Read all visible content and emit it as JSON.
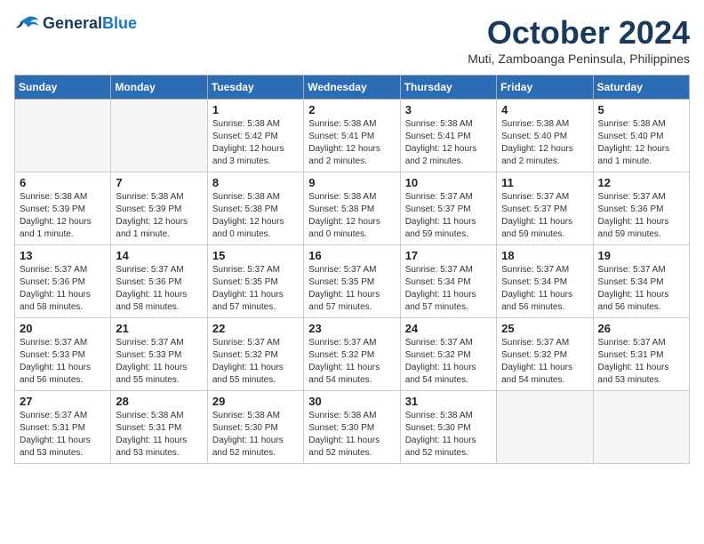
{
  "header": {
    "logo_line1": "General",
    "logo_line2": "Blue",
    "month_title": "October 2024",
    "subtitle": "Muti, Zamboanga Peninsula, Philippines"
  },
  "weekdays": [
    "Sunday",
    "Monday",
    "Tuesday",
    "Wednesday",
    "Thursday",
    "Friday",
    "Saturday"
  ],
  "weeks": [
    [
      {
        "day": "",
        "empty": true
      },
      {
        "day": "",
        "empty": true
      },
      {
        "day": "1",
        "sunrise": "Sunrise: 5:38 AM",
        "sunset": "Sunset: 5:42 PM",
        "daylight": "Daylight: 12 hours and 3 minutes."
      },
      {
        "day": "2",
        "sunrise": "Sunrise: 5:38 AM",
        "sunset": "Sunset: 5:41 PM",
        "daylight": "Daylight: 12 hours and 2 minutes."
      },
      {
        "day": "3",
        "sunrise": "Sunrise: 5:38 AM",
        "sunset": "Sunset: 5:41 PM",
        "daylight": "Daylight: 12 hours and 2 minutes."
      },
      {
        "day": "4",
        "sunrise": "Sunrise: 5:38 AM",
        "sunset": "Sunset: 5:40 PM",
        "daylight": "Daylight: 12 hours and 2 minutes."
      },
      {
        "day": "5",
        "sunrise": "Sunrise: 5:38 AM",
        "sunset": "Sunset: 5:40 PM",
        "daylight": "Daylight: 12 hours and 1 minute."
      }
    ],
    [
      {
        "day": "6",
        "sunrise": "Sunrise: 5:38 AM",
        "sunset": "Sunset: 5:39 PM",
        "daylight": "Daylight: 12 hours and 1 minute."
      },
      {
        "day": "7",
        "sunrise": "Sunrise: 5:38 AM",
        "sunset": "Sunset: 5:39 PM",
        "daylight": "Daylight: 12 hours and 1 minute."
      },
      {
        "day": "8",
        "sunrise": "Sunrise: 5:38 AM",
        "sunset": "Sunset: 5:38 PM",
        "daylight": "Daylight: 12 hours and 0 minutes."
      },
      {
        "day": "9",
        "sunrise": "Sunrise: 5:38 AM",
        "sunset": "Sunset: 5:38 PM",
        "daylight": "Daylight: 12 hours and 0 minutes."
      },
      {
        "day": "10",
        "sunrise": "Sunrise: 5:37 AM",
        "sunset": "Sunset: 5:37 PM",
        "daylight": "Daylight: 11 hours and 59 minutes."
      },
      {
        "day": "11",
        "sunrise": "Sunrise: 5:37 AM",
        "sunset": "Sunset: 5:37 PM",
        "daylight": "Daylight: 11 hours and 59 minutes."
      },
      {
        "day": "12",
        "sunrise": "Sunrise: 5:37 AM",
        "sunset": "Sunset: 5:36 PM",
        "daylight": "Daylight: 11 hours and 59 minutes."
      }
    ],
    [
      {
        "day": "13",
        "sunrise": "Sunrise: 5:37 AM",
        "sunset": "Sunset: 5:36 PM",
        "daylight": "Daylight: 11 hours and 58 minutes."
      },
      {
        "day": "14",
        "sunrise": "Sunrise: 5:37 AM",
        "sunset": "Sunset: 5:36 PM",
        "daylight": "Daylight: 11 hours and 58 minutes."
      },
      {
        "day": "15",
        "sunrise": "Sunrise: 5:37 AM",
        "sunset": "Sunset: 5:35 PM",
        "daylight": "Daylight: 11 hours and 57 minutes."
      },
      {
        "day": "16",
        "sunrise": "Sunrise: 5:37 AM",
        "sunset": "Sunset: 5:35 PM",
        "daylight": "Daylight: 11 hours and 57 minutes."
      },
      {
        "day": "17",
        "sunrise": "Sunrise: 5:37 AM",
        "sunset": "Sunset: 5:34 PM",
        "daylight": "Daylight: 11 hours and 57 minutes."
      },
      {
        "day": "18",
        "sunrise": "Sunrise: 5:37 AM",
        "sunset": "Sunset: 5:34 PM",
        "daylight": "Daylight: 11 hours and 56 minutes."
      },
      {
        "day": "19",
        "sunrise": "Sunrise: 5:37 AM",
        "sunset": "Sunset: 5:34 PM",
        "daylight": "Daylight: 11 hours and 56 minutes."
      }
    ],
    [
      {
        "day": "20",
        "sunrise": "Sunrise: 5:37 AM",
        "sunset": "Sunset: 5:33 PM",
        "daylight": "Daylight: 11 hours and 56 minutes."
      },
      {
        "day": "21",
        "sunrise": "Sunrise: 5:37 AM",
        "sunset": "Sunset: 5:33 PM",
        "daylight": "Daylight: 11 hours and 55 minutes."
      },
      {
        "day": "22",
        "sunrise": "Sunrise: 5:37 AM",
        "sunset": "Sunset: 5:32 PM",
        "daylight": "Daylight: 11 hours and 55 minutes."
      },
      {
        "day": "23",
        "sunrise": "Sunrise: 5:37 AM",
        "sunset": "Sunset: 5:32 PM",
        "daylight": "Daylight: 11 hours and 54 minutes."
      },
      {
        "day": "24",
        "sunrise": "Sunrise: 5:37 AM",
        "sunset": "Sunset: 5:32 PM",
        "daylight": "Daylight: 11 hours and 54 minutes."
      },
      {
        "day": "25",
        "sunrise": "Sunrise: 5:37 AM",
        "sunset": "Sunset: 5:32 PM",
        "daylight": "Daylight: 11 hours and 54 minutes."
      },
      {
        "day": "26",
        "sunrise": "Sunrise: 5:37 AM",
        "sunset": "Sunset: 5:31 PM",
        "daylight": "Daylight: 11 hours and 53 minutes."
      }
    ],
    [
      {
        "day": "27",
        "sunrise": "Sunrise: 5:37 AM",
        "sunset": "Sunset: 5:31 PM",
        "daylight": "Daylight: 11 hours and 53 minutes."
      },
      {
        "day": "28",
        "sunrise": "Sunrise: 5:38 AM",
        "sunset": "Sunset: 5:31 PM",
        "daylight": "Daylight: 11 hours and 53 minutes."
      },
      {
        "day": "29",
        "sunrise": "Sunrise: 5:38 AM",
        "sunset": "Sunset: 5:30 PM",
        "daylight": "Daylight: 11 hours and 52 minutes."
      },
      {
        "day": "30",
        "sunrise": "Sunrise: 5:38 AM",
        "sunset": "Sunset: 5:30 PM",
        "daylight": "Daylight: 11 hours and 52 minutes."
      },
      {
        "day": "31",
        "sunrise": "Sunrise: 5:38 AM",
        "sunset": "Sunset: 5:30 PM",
        "daylight": "Daylight: 11 hours and 52 minutes."
      },
      {
        "day": "",
        "empty": true
      },
      {
        "day": "",
        "empty": true
      }
    ]
  ]
}
